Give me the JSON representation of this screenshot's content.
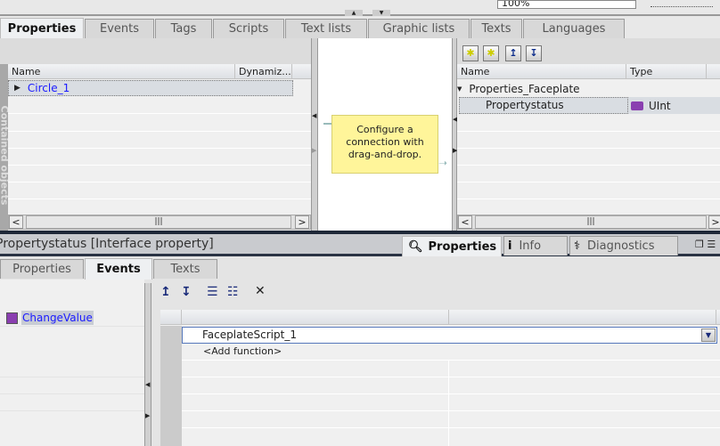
{
  "top": {
    "zoom": "100%"
  },
  "editor_tabs": [
    "Properties",
    "Events",
    "Tags",
    "Scripts",
    "Text lists",
    "Graphic lists",
    "Texts",
    "Languages"
  ],
  "left_panel": {
    "side_label": "Contained objects",
    "columns": [
      "Name",
      "Dynamiz..."
    ],
    "rows": [
      {
        "name": "Circle_1"
      }
    ]
  },
  "hint": "Configure a connection with drag-and-drop.",
  "right_panel": {
    "columns": [
      "Name",
      "Type"
    ],
    "group": "Properties_Faceplate",
    "rows": [
      {
        "name": "Propertystatus",
        "type": "UInt"
      }
    ]
  },
  "inspector": {
    "title": "Propertystatus [Interface property]",
    "tabs": [
      "Properties",
      "Info",
      "Diagnostics"
    ],
    "subtabs": [
      "Properties",
      "Events",
      "Texts"
    ],
    "events": [
      "ChangeValue"
    ],
    "functions": [
      "FaceplateScript_1",
      "<Add function>"
    ]
  }
}
